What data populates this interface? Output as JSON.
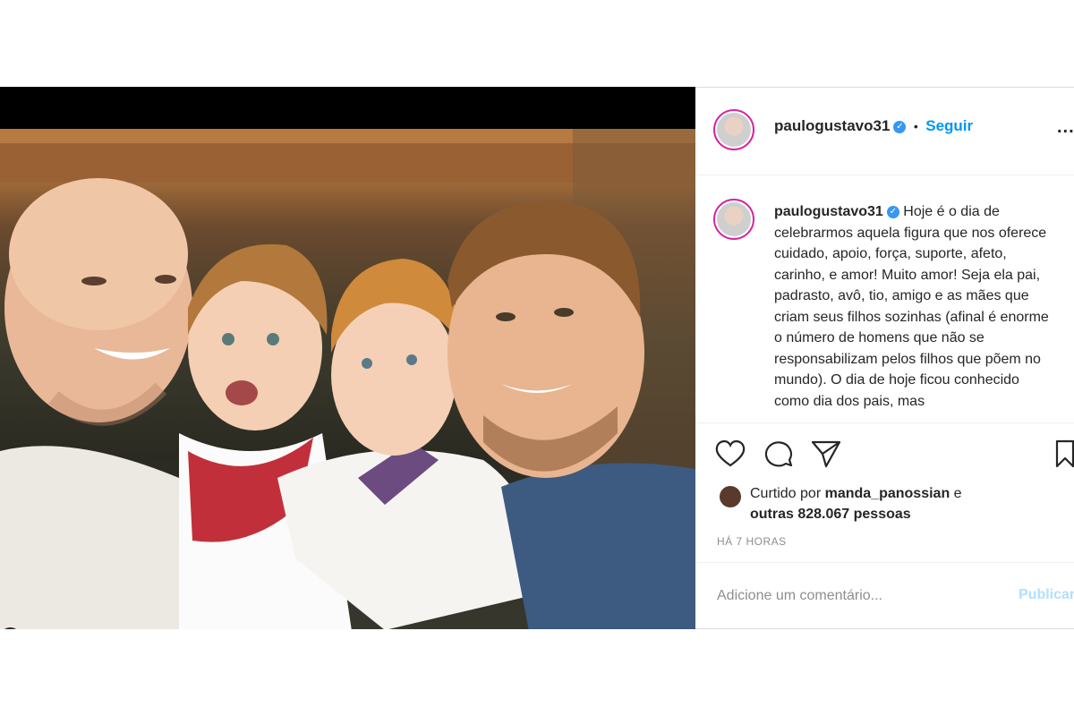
{
  "post": {
    "username": "paulogustavo31",
    "follow_label": "Seguir",
    "separator": "•",
    "more_label": "...",
    "caption": "Hoje é o dia de celebrarmos aquela figura que nos oferece cuidado, apoio, força, suporte, afeto, carinho, e amor! Muito amor! Seja ela pai, padrasto, avô, tio, amigo e as mães que criam seus filhos sozinhas (afinal é enorme o número de homens que não se responsabilizam pelos filhos que põem no mundo). O dia de hoje ficou conhecido como dia dos pais, mas",
    "liked_by_prefix": "Curtido por",
    "liked_by_user": "manda_panossian",
    "liked_by_conj": "e",
    "likes_others": "outras 828.067 pessoas",
    "time_ago": "HÁ 7 HORAS",
    "comment_placeholder": "Adicione um comentário...",
    "publish_label": "Publicar"
  },
  "icons": {
    "verified": "verified-badge-icon",
    "like": "heart-icon",
    "comment": "comment-icon",
    "share": "paper-plane-icon",
    "save": "bookmark-icon",
    "user_tag": "user-tag-icon"
  },
  "colors": {
    "accent": "#0095f6",
    "verified": "#3897f0",
    "publish_disabled": "#b2dffc",
    "muted": "#8e8e8e"
  }
}
